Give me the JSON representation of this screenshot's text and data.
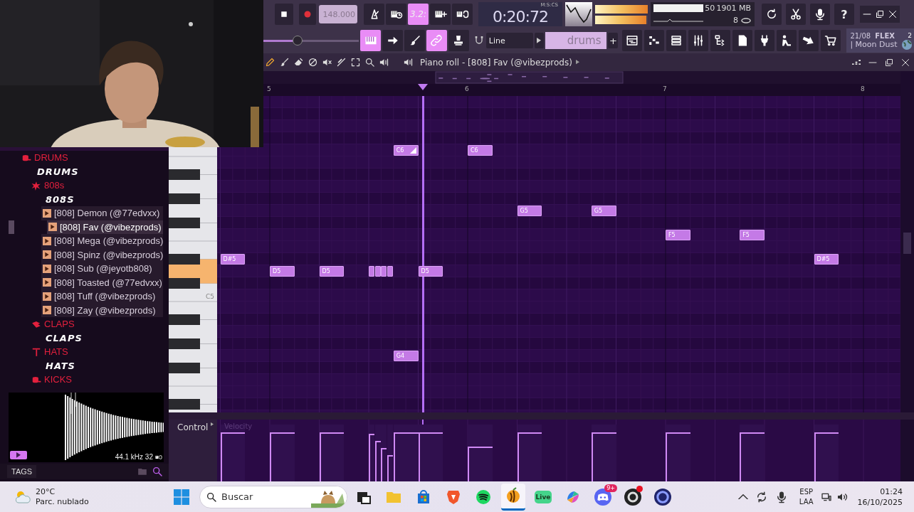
{
  "toolbar": {
    "tempo": "148.000",
    "tools": [
      {
        "on": false
      },
      {
        "on": false
      },
      {
        "label": "3.2:",
        "on": true
      },
      {
        "on": false
      },
      {
        "on": false
      }
    ],
    "time": "0:20:72",
    "time_format": "M:S:CS",
    "peak_meter": [
      {
        "level": 1
      },
      {
        "level": 0.97
      }
    ],
    "cpu": "50",
    "memory": "1901 MB",
    "voices": "8",
    "help": "?",
    "master_volume": {
      "level": 0.36
    },
    "modes": [
      {
        "on": true
      },
      {
        "on": false
      },
      {
        "on": false
      },
      {
        "on": true
      },
      {
        "on": false
      }
    ],
    "snap": "Line",
    "pattern": "drums",
    "add": "+",
    "news": {
      "date": "21/08",
      "tag": "FLEX",
      "title": "| Moon Dust",
      "badge": "2"
    }
  },
  "browser": {
    "tree": [
      {
        "kind": "folder",
        "label": "DRUMS",
        "children": [
          {
            "kind": "banner",
            "label": "DRUMS"
          },
          {
            "kind": "folder",
            "label": "808s",
            "children": [
              {
                "kind": "banner",
                "label": "808S"
              },
              {
                "kind": "file",
                "label": "[808] Demon (@77edvxx)",
                "selected": false
              },
              {
                "kind": "file",
                "label": "[808] Fav (@vibezprods)",
                "selected": true
              },
              {
                "kind": "file",
                "label": "[808] Mega (@vibezprods)",
                "selected": false
              },
              {
                "kind": "file",
                "label": "[808] Spinz (@vibezprods)",
                "selected": false
              },
              {
                "kind": "file",
                "label": "[808] Sub (@jeyotb808)",
                "selected": false
              },
              {
                "kind": "file",
                "label": "[808] Toasted (@77edvxx)",
                "selected": false
              },
              {
                "kind": "file",
                "label": "[808] Tuff (@vibezprods)",
                "selected": false
              },
              {
                "kind": "file",
                "label": "[808] Zay (@vibezprods)",
                "selected": false
              }
            ]
          },
          {
            "kind": "folder",
            "label": "CLAPS",
            "children": [
              {
                "kind": "banner",
                "label": "CLAPS"
              }
            ]
          },
          {
            "kind": "folder",
            "label": "HATS",
            "children": [
              {
                "kind": "banner",
                "label": "HATS"
              }
            ]
          },
          {
            "kind": "folder",
            "label": "KICKS"
          }
        ]
      }
    ],
    "sample": {
      "info": "44.1 kHz 32"
    },
    "tags": "TAGS"
  },
  "piano_roll": {
    "title": "Piano roll - [808] Fav (@vibezprods)",
    "ruler": [
      "5",
      "6",
      "7",
      "8"
    ],
    "key_labels": [
      "C5"
    ],
    "notes": [
      {
        "label": "D#5",
        "level": 0.86,
        "slide": false
      },
      {
        "label": "D5",
        "level": 0.86,
        "slide": false
      },
      {
        "label": "D5",
        "level": 0.86,
        "slide": false
      },
      {
        "level": 0.84,
        "slide": false
      },
      {
        "level": 0.71,
        "slide": false
      },
      {
        "level": 0.59,
        "slide": false
      },
      {
        "level": 0.46,
        "slide": false
      },
      {
        "label": "C6",
        "level": 0.86,
        "slide": true
      },
      {
        "label": "G4",
        "slide": false
      },
      {
        "label": "D5",
        "level": 0.86,
        "slide": false
      },
      {
        "label": "C6",
        "level": 0.61,
        "slide": false
      },
      {
        "label": "G5",
        "level": 0.86,
        "slide": false
      },
      {
        "label": "G5",
        "level": 0.86,
        "slide": false
      },
      {
        "label": "F5",
        "level": 0.86,
        "slide": false
      },
      {
        "label": "F5",
        "level": 0.86,
        "slide": false
      },
      {
        "label": "D#5",
        "level": 0.86,
        "slide": false
      }
    ],
    "control": "Control",
    "lane": "Velocity"
  },
  "taskbar": {
    "weather": {
      "temp": "20°C",
      "desc": "Parc. nublado"
    },
    "search": {
      "placeholder": "Buscar"
    },
    "apps": [
      {
        "active": false
      },
      {
        "active": false
      },
      {
        "active": false
      },
      {
        "active": false
      },
      {
        "active": false
      },
      {
        "active": true
      },
      {
        "label": "Live",
        "active": false
      },
      {
        "active": false
      },
      {
        "badge": "9+",
        "active": false
      },
      {
        "alert": true,
        "active": false
      },
      {
        "active": false
      }
    ],
    "language": [
      "ESP",
      "LAA"
    ],
    "clock": {
      "time": "01:24",
      "date": "16/10/2025"
    }
  }
}
